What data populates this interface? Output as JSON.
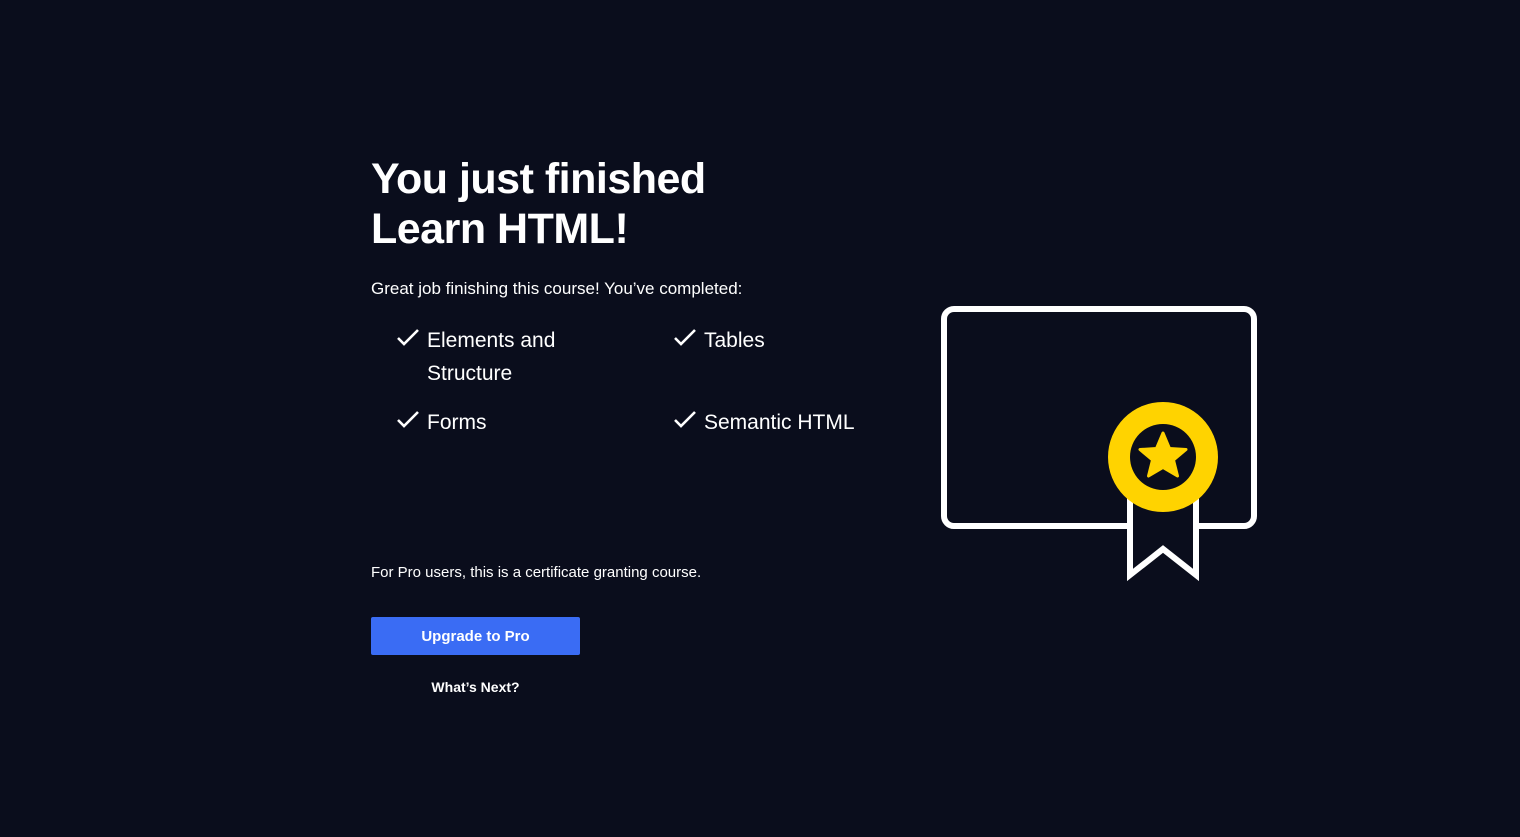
{
  "completion": {
    "title_line1": "You just finished",
    "title_line2": "Learn HTML!",
    "intro": "Great job finishing this course! You’ve completed:",
    "completed_items": [
      {
        "label": "Elements and Structure",
        "icon": "checkmark-icon"
      },
      {
        "label": "Tables",
        "icon": "checkmark-icon"
      },
      {
        "label": "Forms",
        "icon": "checkmark-icon"
      },
      {
        "label": "Semantic HTML",
        "icon": "checkmark-icon"
      }
    ],
    "pro_note": "For Pro users, this is a certificate granting course.",
    "upgrade_label": "Upgrade to Pro",
    "whats_next_label": "What’s Next?"
  },
  "illustration": {
    "icon": "certificate-icon",
    "badge_icon": "star-badge-icon"
  },
  "colors": {
    "background": "#0a0d1c",
    "text": "#ffffff",
    "button": "#3a6cf4",
    "badge": "#ffd300"
  }
}
